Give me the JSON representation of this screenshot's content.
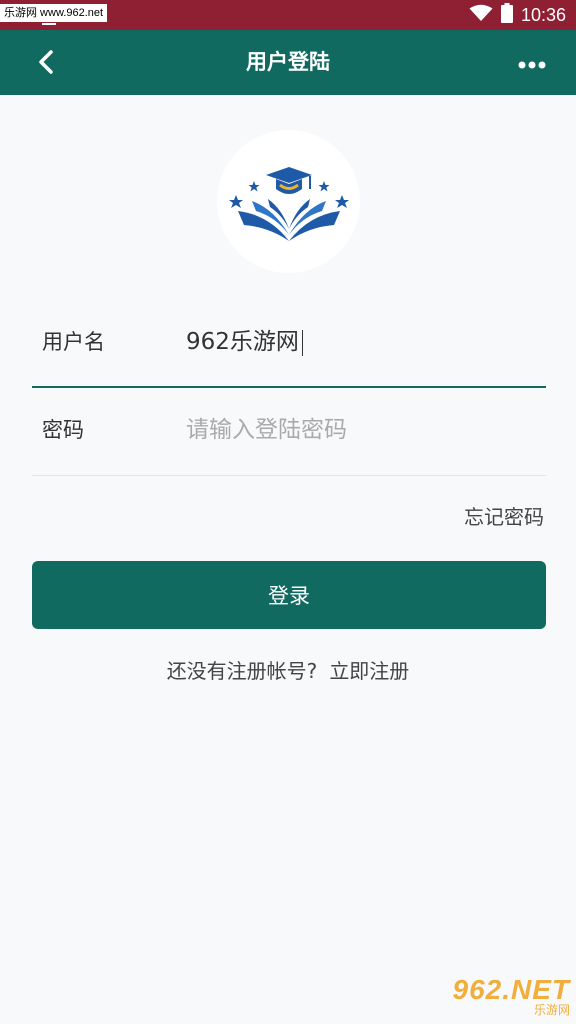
{
  "status_bar": {
    "watermark": "乐游网 www.962.net",
    "time": "10:36",
    "icons": [
      "wifi-icon",
      "battery-icon"
    ],
    "background_color": "#8f2034"
  },
  "app_bar": {
    "title": "用户登陆",
    "back_icon": "chevron-left-icon",
    "more_icon": "more-horizontal-icon",
    "background_color": "#116a60"
  },
  "logo": {
    "icon": "education-book-cap-logo",
    "colors": [
      "#1e5aa8",
      "#f0b429"
    ]
  },
  "form": {
    "username": {
      "label": "用户名",
      "value": "962乐游网"
    },
    "password": {
      "label": "密码",
      "placeholder": "请输入登陆密码"
    },
    "forgot_label": "忘记密码",
    "login_label": "登录"
  },
  "register": {
    "prompt": "还没有注册帐号?",
    "link_label": "立即注册"
  },
  "bottom_watermark": {
    "big": "962.NET",
    "small": "乐游网"
  },
  "accent_color": "#116a60"
}
